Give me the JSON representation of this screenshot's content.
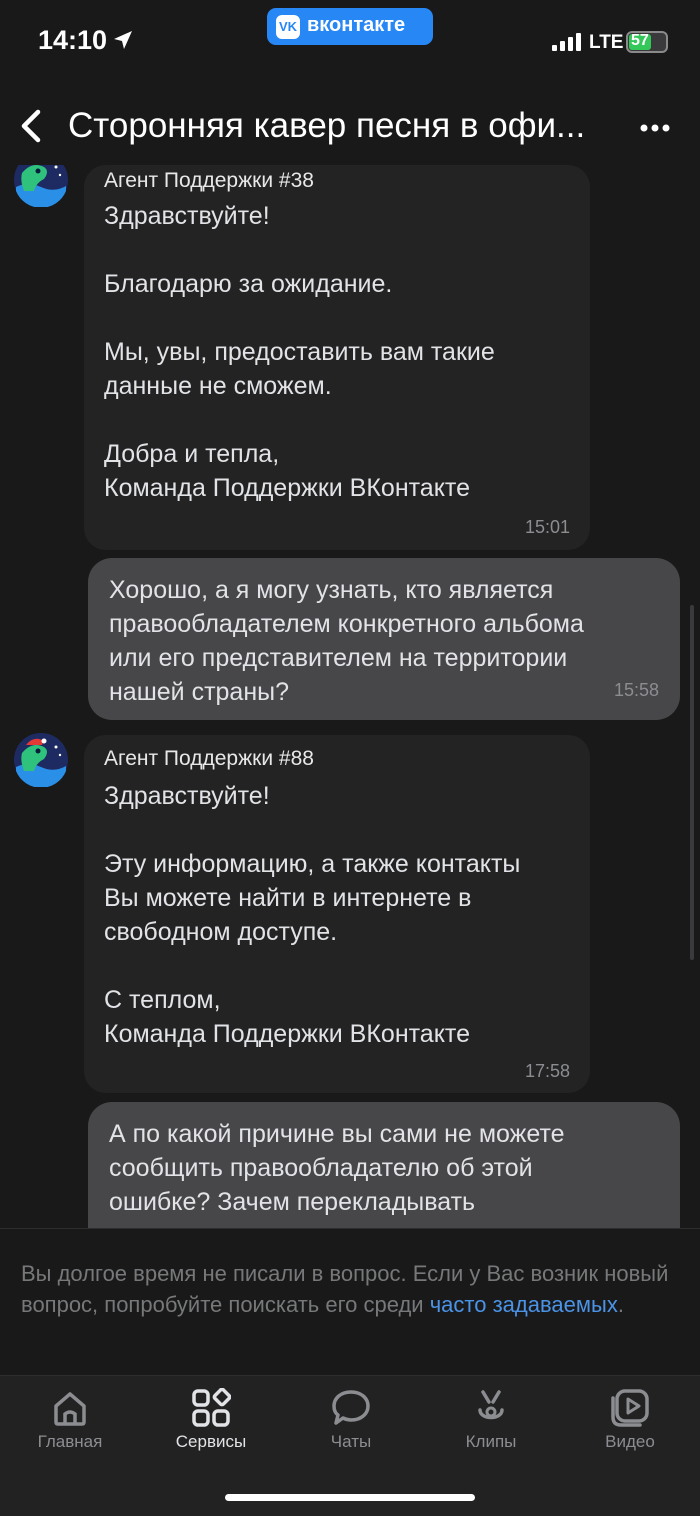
{
  "status": {
    "time": "14:10",
    "network": "LTE",
    "battery": "57",
    "app_badge": "вконтакте"
  },
  "header": {
    "title": "Сторонняя кавер песня в офи..."
  },
  "messages": [
    {
      "sender": "Агент Поддержки #38",
      "text": "Здравствуйте!\n\nБлагодарю за ожидание.\n\nМы, увы, предоставить вам такие\nданные не сможем.\n\nДобра и тепла,\nКоманда Поддержки ВКонтакте",
      "time": "15:01"
    },
    {
      "text": "Хорошо, а я могу узнать, кто является\nправообладателем конкретного альбома\nили его представителем на территории\nнашей страны?",
      "time": "15:58"
    },
    {
      "sender": "Агент Поддержки #88",
      "text": "Здравствуйте!\n\nЭту информацию, а также контакты\nВы можете найти в интернете в\nсвободном доступе.\n\nС теплом,\nКоманда Поддержки ВКонтакте",
      "time": "17:58"
    },
    {
      "text": "А по какой причине вы сами не можете\nсообщить правообладателю об этой\nошибке? Зачем перекладывать"
    }
  ],
  "notice": {
    "text": "Вы долгое время не писали в вопрос. Если у Вас возник новый вопрос, попробуйте поискать его среди ",
    "link": "часто задаваемых",
    "suffix": "."
  },
  "tabs": [
    {
      "label": "Главная",
      "icon": "home-icon"
    },
    {
      "label": "Сервисы",
      "icon": "services-icon",
      "active": true
    },
    {
      "label": "Чаты",
      "icon": "chat-icon"
    },
    {
      "label": "Клипы",
      "icon": "clips-icon"
    },
    {
      "label": "Видео",
      "icon": "video-icon"
    }
  ],
  "colors": {
    "background": "#19191a",
    "incoming_bubble": "#232324",
    "outgoing_bubble": "#474749",
    "link": "#4b93e6",
    "vk_blue": "#2787f5"
  }
}
